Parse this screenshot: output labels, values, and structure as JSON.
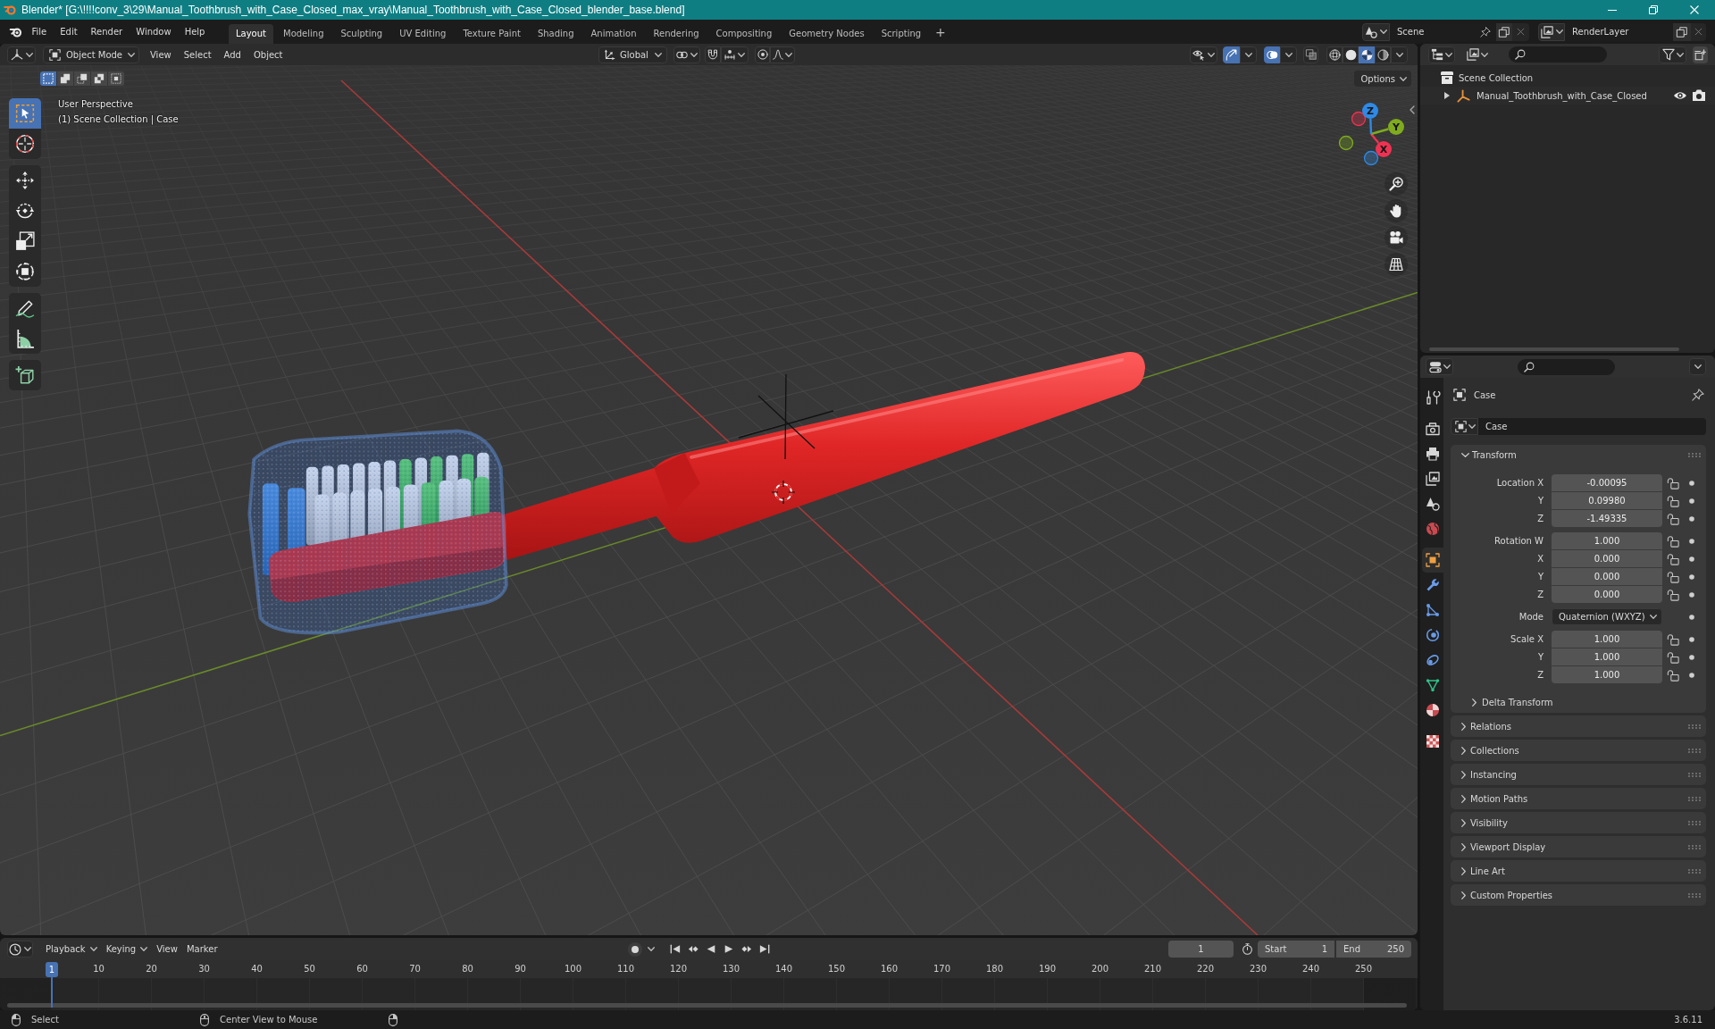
{
  "window": {
    "title": "Blender* [G:\\!!!!conv_3\\29\\Manual_Toothbrush_with_Case_Closed_max_vray\\Manual_Toothbrush_with_Case_Closed_blender_base.blend]"
  },
  "top_bar": {
    "menus": [
      "File",
      "Edit",
      "Render",
      "Window",
      "Help"
    ],
    "workspaces": [
      {
        "label": "Layout",
        "selected": true
      },
      {
        "label": "Modeling",
        "selected": false
      },
      {
        "label": "Sculpting",
        "selected": false
      },
      {
        "label": "UV Editing",
        "selected": false
      },
      {
        "label": "Texture Paint",
        "selected": false
      },
      {
        "label": "Shading",
        "selected": false
      },
      {
        "label": "Animation",
        "selected": false
      },
      {
        "label": "Rendering",
        "selected": false
      },
      {
        "label": "Compositing",
        "selected": false
      },
      {
        "label": "Geometry Nodes",
        "selected": false
      },
      {
        "label": "Scripting",
        "selected": false
      }
    ],
    "add_workspace": "+",
    "scene": "Scene",
    "view_layer": "RenderLayer"
  },
  "viewport": {
    "header": {
      "mode": "Object Mode",
      "menus": [
        "View",
        "Select",
        "Add",
        "Object"
      ],
      "orientation": "Global",
      "toggles": [
        {
          "kind": "snap",
          "on": false
        },
        {
          "kind": "proportional",
          "on": false
        },
        {
          "kind": "gizmos",
          "on": true
        },
        {
          "kind": "overlays",
          "on": true
        },
        {
          "kind": "xray",
          "on": false
        }
      ],
      "shading": [
        {
          "kind": "wireframe",
          "selected": false
        },
        {
          "kind": "solid",
          "selected": false
        },
        {
          "kind": "material",
          "selected": true
        },
        {
          "kind": "rendered",
          "selected": false
        }
      ]
    },
    "select_modes": [
      {
        "kind": "set",
        "selected": true
      },
      {
        "kind": "extend",
        "selected": false
      },
      {
        "kind": "subtract",
        "selected": false
      },
      {
        "kind": "invert",
        "selected": false
      },
      {
        "kind": "intersect",
        "selected": false
      }
    ],
    "options": "Options",
    "view_name": "User Perspective",
    "context": "(1) Scene Collection | Case",
    "tools": [
      {
        "kind": "select_box",
        "selected": true
      },
      {
        "kind": "cursor",
        "selected": false
      },
      {
        "kind": "move",
        "selected": false
      },
      {
        "kind": "rotate",
        "selected": false
      },
      {
        "kind": "scale",
        "selected": false
      },
      {
        "kind": "transform",
        "selected": false
      },
      {
        "kind": "annotate",
        "selected": false
      },
      {
        "kind": "measure",
        "selected": false
      },
      {
        "kind": "add_cube",
        "selected": false
      }
    ],
    "gizmo_axes": [
      {
        "label": "X",
        "color": "#ee3352"
      },
      {
        "label": "Y",
        "color": "#7fab1e"
      },
      {
        "label": "Z",
        "color": "#2e8ae6"
      }
    ]
  },
  "outliner": {
    "tree": [
      {
        "name": "Scene Collection",
        "children": [
          {
            "name": "Manual_Toothbrush_with_Case_Closed",
            "expanded": false,
            "visible": true
          }
        ]
      }
    ]
  },
  "properties": {
    "tabs": [
      {
        "kind": "tool",
        "selected": false
      },
      {
        "kind": "render",
        "selected": false
      },
      {
        "kind": "output",
        "selected": false
      },
      {
        "kind": "view_layer",
        "selected": false
      },
      {
        "kind": "scene",
        "selected": false
      },
      {
        "kind": "world",
        "selected": false
      },
      {
        "kind": "object",
        "selected": true
      },
      {
        "kind": "modifiers",
        "selected": false
      },
      {
        "kind": "particles",
        "selected": false
      },
      {
        "kind": "physics",
        "selected": false
      },
      {
        "kind": "constraints",
        "selected": false
      },
      {
        "kind": "data",
        "selected": false
      },
      {
        "kind": "material",
        "selected": false
      },
      {
        "kind": "texture",
        "selected": false
      }
    ],
    "context": "Case",
    "object_name": "Case",
    "transform": {
      "title": "Transform",
      "expanded": true,
      "groups": [
        [
          {
            "kind": "number",
            "label": "Location X",
            "value": "-0.00095",
            "locked": false
          },
          {
            "kind": "number",
            "label": "Y",
            "value": "0.09980",
            "locked": false
          },
          {
            "kind": "number",
            "label": "Z",
            "value": "-1.49335",
            "locked": false
          }
        ],
        [
          {
            "kind": "number",
            "label": "Rotation W",
            "value": "1.000",
            "locked": false
          },
          {
            "kind": "number",
            "label": "X",
            "value": "0.000",
            "locked": false
          },
          {
            "kind": "number",
            "label": "Y",
            "value": "0.000",
            "locked": false
          },
          {
            "kind": "number",
            "label": "Z",
            "value": "0.000",
            "locked": false
          }
        ],
        [
          {
            "kind": "dropdown",
            "label": "Mode",
            "value": "Quaternion (WXYZ)"
          }
        ],
        [
          {
            "kind": "number",
            "label": "Scale X",
            "value": "1.000",
            "locked": false
          },
          {
            "kind": "number",
            "label": "Y",
            "value": "1.000",
            "locked": false
          },
          {
            "kind": "number",
            "label": "Z",
            "value": "1.000",
            "locked": false
          }
        ]
      ],
      "delta": {
        "title": "Delta Transform",
        "expanded": false
      }
    },
    "panels": [
      {
        "title": "Relations",
        "expanded": false
      },
      {
        "title": "Collections",
        "expanded": false
      },
      {
        "title": "Instancing",
        "expanded": false
      },
      {
        "title": "Motion Paths",
        "expanded": false
      },
      {
        "title": "Visibility",
        "expanded": false
      },
      {
        "title": "Viewport Display",
        "expanded": false
      },
      {
        "title": "Line Art",
        "expanded": false
      },
      {
        "title": "Custom Properties",
        "expanded": false
      }
    ]
  },
  "timeline": {
    "menus": [
      {
        "label": "Playback",
        "kind": "dropdown"
      },
      {
        "label": "Keying",
        "kind": "dropdown"
      },
      {
        "label": "View",
        "kind": "menu"
      },
      {
        "label": "Marker",
        "kind": "menu"
      }
    ],
    "current_frame": "1",
    "start": {
      "label": "Start",
      "value": "1"
    },
    "end": {
      "label": "End",
      "value": "250"
    },
    "playhead": "1",
    "ruler": [
      "10",
      "20",
      "30",
      "40",
      "50",
      "60",
      "70",
      "80",
      "90",
      "100",
      "110",
      "120",
      "130",
      "140",
      "150",
      "160",
      "170",
      "180",
      "190",
      "200",
      "210",
      "220",
      "230",
      "240",
      "250"
    ]
  },
  "status_bar": {
    "hints": [
      {
        "kind": "left_mouse",
        "label": "Select"
      },
      {
        "kind": "middle_mouse",
        "label": "Center View to Mouse"
      }
    ],
    "version": "3.6.11"
  }
}
